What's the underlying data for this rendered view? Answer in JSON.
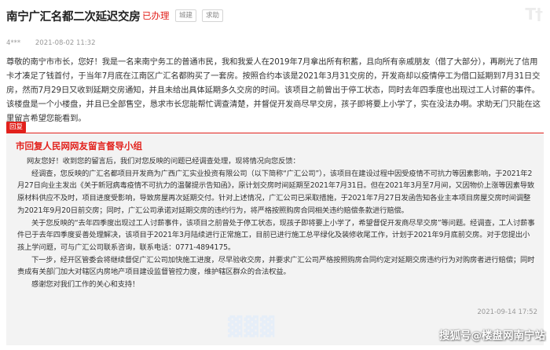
{
  "post": {
    "title": "南宁广汇名都二次延迟交房",
    "status": "已办理",
    "tags": [
      "城建",
      "求助"
    ],
    "author": "4***",
    "date": "2021-08-02 11:32",
    "message": "尊敬的南宁市市长，您好！我是一名来南宁务工的普通市民，我和我爱人在2019年7月拿出所有积蓄，且向所有亲戚朋友（借了大部分），再刷光了信用卡才凑足了钱首付，于当年7月底在江南区广汇名都购买了一套房。按照合约本该是2021年3月31交房的，开发商却以疫情停工为借口延期到7月31日交房，然而7月29日又收到延期交房通知，并且未给出具体延期多久交房的时间。该项目之前曾出于停工状态，同时去年四季度也出现过工人讨薪的事件。该楼盘是一个小楼盘，并且已全部售空，恳求市长您能帮忙调查清楚，并督促开发商尽早交房，孩子即将要上小学了，实在没法办啊。求助无门只能在这里留言希望您能看到。"
  },
  "reply": {
    "label": "回复",
    "replier": "市回复人民网网友留言督导小组",
    "paragraphs": [
      "网友您好！收到您的留言后，我们对您反映的问题已经调查处理，现将情况向您反馈：",
      "经调查，您反映的广汇名都项目开发商为广西广汇实业投资有限公司（以下简称“广汇公司”），该项目在建设过程中因受疫情不可抗力等因素影响，于2021年2月27日向业主发出《关于新冠病毒疫情不可抗力的温馨提示告知函》，原计划交房时间延期至2021年7月31日。但在2021年3月至7月间，又因物价上涨等因素导致原材料供应不及时，项目进度受影响，导致房屋再次延期交付。针对上述情况，广汇公司已采取措施，于2021年7月27日发函告知各业主本项目房屋交房时间调整为2021年9月20日前交房；同时，广汇公司承诺对延期交房的违约行为，将严格按照购房合同相关违约赔偿条款进行赔偿。",
      "关于您反映的“去年四季度出现过工人讨薪事件，该项目之前曾处于停工状态，现孩子即将要上小学了，希望督促开发商尽早交房”等问题。经调查，工人讨薪事件已于去年四季度妥善处理解决，该项目于2021年3月陆续进行正常施工，目前已进行施工总平绿化及装修收尾工作，计划于2021年9月底前交房。对于您提出小孩上学问题，可与广汇公司联系咨询，联系电话：0771-4894175。",
      "下一步，经开区管委会将继续督促广汇公司加快施工进度，尽早验收交房，并要求广汇公司严格按照购房合同约定对延期交房违约行为对购房者进行赔偿；同时责成有关部门加大对辖区内房地产项目建设监督管控力度，维护辖区群众的合法权益。",
      "感谢您对我们工作的关心和支持！"
    ],
    "date": "2021-09-14 17:52"
  },
  "watermark": "搜狐号@楼盘网南宁站",
  "colors": {
    "accent": "#e2211c",
    "reply_bg": "#f3f3f3"
  }
}
